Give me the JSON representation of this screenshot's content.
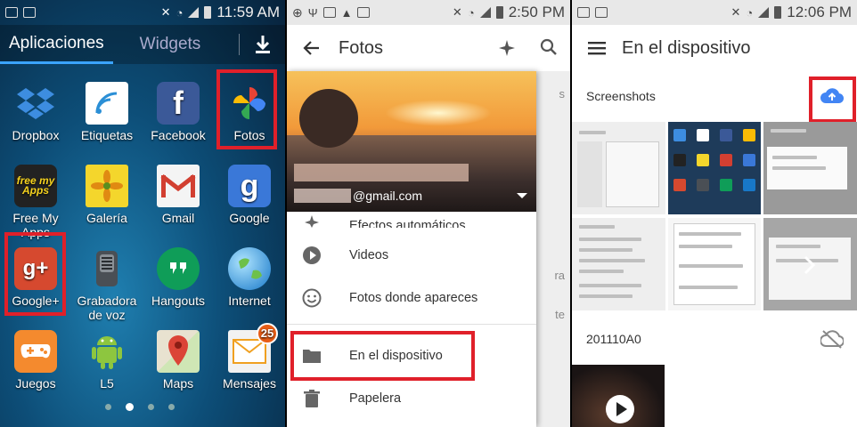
{
  "panel1": {
    "status": {
      "time": "11:59 AM"
    },
    "tabs": {
      "apps": "Aplicaciones",
      "widgets": "Widgets"
    },
    "apps": [
      {
        "label": "Dropbox",
        "icon": "dropbox-icon"
      },
      {
        "label": "Etiquetas",
        "icon": "nfc-tag-icon"
      },
      {
        "label": "Facebook",
        "icon": "facebook-icon"
      },
      {
        "label": "Fotos",
        "icon": "google-photos-icon"
      },
      {
        "label": "Free My Apps",
        "icon": "freemyapps-icon"
      },
      {
        "label": "Galería",
        "icon": "gallery-icon"
      },
      {
        "label": "Gmail",
        "icon": "gmail-icon"
      },
      {
        "label": "Google",
        "icon": "google-search-icon"
      },
      {
        "label": "Google+",
        "icon": "google-plus-icon"
      },
      {
        "label": "Grabadora de voz",
        "icon": "voice-recorder-icon"
      },
      {
        "label": "Hangouts",
        "icon": "hangouts-icon"
      },
      {
        "label": "Internet",
        "icon": "internet-globe-icon"
      },
      {
        "label": "Juegos",
        "icon": "games-controller-icon"
      },
      {
        "label": "L5",
        "icon": "android-icon"
      },
      {
        "label": "Maps",
        "icon": "maps-icon"
      },
      {
        "label": "Mensajes",
        "icon": "messages-icon",
        "badge": "25"
      }
    ],
    "app_icon_text": {
      "facebook": "f",
      "google": "g",
      "googleplus": "g+",
      "freemyapps": "free my Apps"
    }
  },
  "panel2": {
    "status": {
      "time": "2:50 PM"
    },
    "title": "Fotos",
    "account": {
      "email": "@gmail.com"
    },
    "behind": {
      "s": "s",
      "ra": "ra",
      "te": "te"
    },
    "menu": [
      {
        "label": "Efectos automáticos",
        "icon": "auto-effects-icon"
      },
      {
        "label": "Videos",
        "icon": "play-circle-icon"
      },
      {
        "label": "Fotos donde apareces",
        "icon": "face-icon"
      },
      {
        "label": "En el dispositivo",
        "icon": "folder-icon"
      },
      {
        "label": "Papelera",
        "icon": "trash-icon"
      }
    ]
  },
  "panel3": {
    "status": {
      "time": "12:06 PM"
    },
    "title": "En el dispositivo",
    "sections": [
      {
        "label": "Screenshots",
        "icon": "cloud-upload-icon"
      },
      {
        "label": "201110A0",
        "icon": "cloud-off-icon"
      }
    ]
  },
  "colors": {
    "highlight": "#e0202a",
    "accent_blue": "#3ba4ff",
    "upload_blue": "#4285f4"
  }
}
